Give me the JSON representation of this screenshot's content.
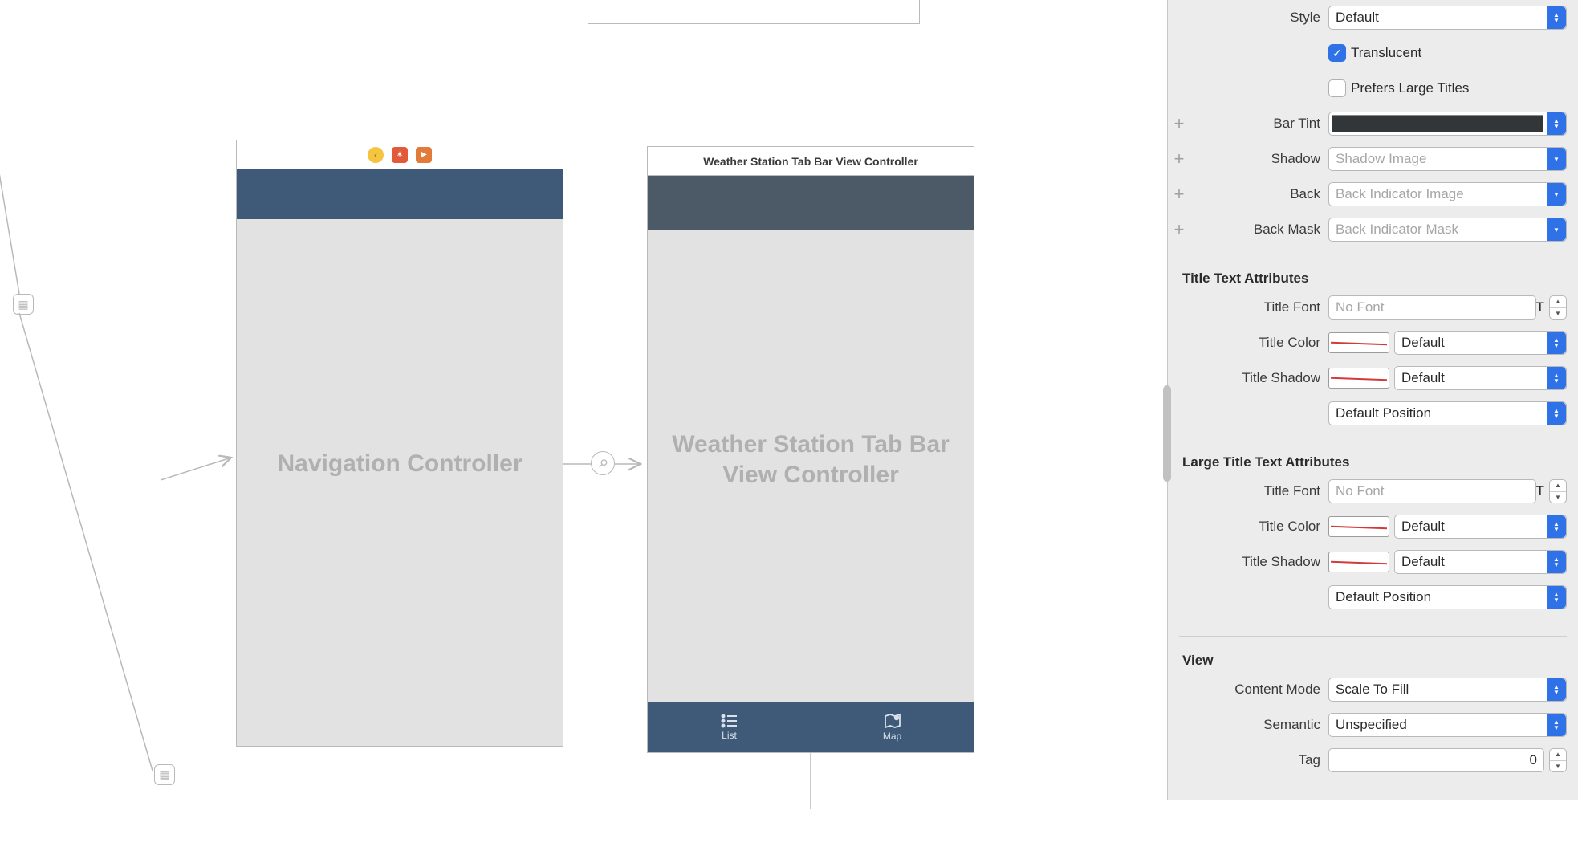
{
  "canvas": {
    "nav_controller": {
      "label": "Navigation Controller"
    },
    "tab_controller": {
      "scene_title": "Weather Station Tab Bar View Controller",
      "body_label": "Weather Station Tab Bar View Controller",
      "tabs": [
        {
          "label": "List",
          "icon": "list-icon"
        },
        {
          "label": "Map",
          "icon": "map-icon"
        }
      ]
    }
  },
  "inspector": {
    "navbar_section": {
      "style_label": "Style",
      "style_value": "Default",
      "translucent_label": "Translucent",
      "translucent_checked": true,
      "prefers_large_label": "Prefers Large Titles",
      "prefers_large_checked": false,
      "bar_tint_label": "Bar Tint",
      "shadow_label": "Shadow",
      "shadow_placeholder": "Shadow Image",
      "back_label": "Back",
      "back_placeholder": "Back Indicator Image",
      "back_mask_label": "Back Mask",
      "back_mask_placeholder": "Back Indicator Mask"
    },
    "title_attrs": {
      "header": "Title Text Attributes",
      "font_label": "Title Font",
      "font_placeholder": "No Font",
      "color_label": "Title Color",
      "color_value": "Default",
      "shadow_label": "Title Shadow",
      "shadow_value": "Default",
      "position_value": "Default Position"
    },
    "large_title_attrs": {
      "header": "Large Title Text Attributes",
      "font_label": "Title Font",
      "font_placeholder": "No Font",
      "color_label": "Title Color",
      "color_value": "Default",
      "shadow_label": "Title Shadow",
      "shadow_value": "Default",
      "position_value": "Default Position"
    },
    "view_section": {
      "header": "View",
      "content_mode_label": "Content Mode",
      "content_mode_value": "Scale To Fill",
      "semantic_label": "Semantic",
      "semantic_value": "Unspecified",
      "tag_label": "Tag",
      "tag_value": "0"
    }
  }
}
